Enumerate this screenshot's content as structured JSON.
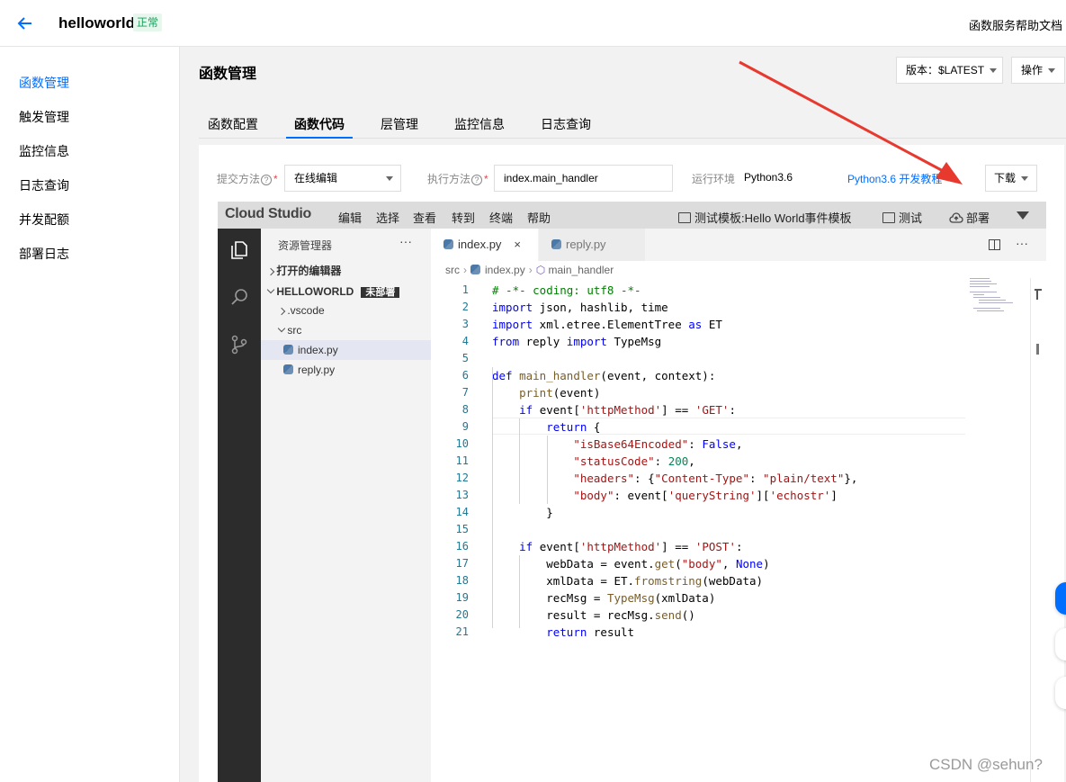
{
  "header": {
    "title": "helloworld",
    "status": "正常",
    "help": "函数服务帮助文档"
  },
  "sidebar": {
    "items": [
      {
        "label": "函数管理",
        "active": true
      },
      {
        "label": "触发管理"
      },
      {
        "label": "监控信息"
      },
      {
        "label": "日志查询"
      },
      {
        "label": "并发配额"
      },
      {
        "label": "部署日志"
      }
    ]
  },
  "main": {
    "title": "函数管理",
    "version_label": "版本：$LATEST",
    "ops_label": "操作",
    "tabs": [
      {
        "label": "函数配置"
      },
      {
        "label": "函数代码",
        "active": true
      },
      {
        "label": "层管理"
      },
      {
        "label": "监控信息"
      },
      {
        "label": "日志查询"
      }
    ]
  },
  "form": {
    "submit_method_label": "提交方法",
    "submit_method_value": "在线编辑",
    "exec_method_label": "执行方法",
    "exec_method_value": "index.main_handler",
    "runtime_label": "运行环境",
    "runtime_value": "Python3.6",
    "tutorial_link": "Python3.6 开发教程",
    "download_label": "下载",
    "help_glyph": "?",
    "required_mark": "*"
  },
  "ide": {
    "logo": "Cloud Studio",
    "menus": [
      "编辑",
      "选择",
      "查看",
      "转到",
      "终端",
      "帮助"
    ],
    "test_template": "测试模板:Hello World事件模板",
    "test": "测试",
    "deploy": "部署",
    "explorer": {
      "title": "资源管理器",
      "dots": "···",
      "open_editors": "打开的编辑器",
      "project": "HELLOWORLD",
      "project_badge": "未部署",
      "items": [
        ".vscode",
        "src",
        "index.py",
        "reply.py"
      ]
    },
    "tabs": [
      {
        "label": "index.py",
        "active": true,
        "close": "×"
      },
      {
        "label": "reply.py"
      }
    ],
    "editor_dots": "···",
    "breadcrumb": [
      "src",
      "index.py",
      "main_handler"
    ],
    "code_lines": [
      "# -*- coding: utf8 -*-",
      "import json, hashlib, time",
      "import xml.etree.ElementTree as ET",
      "from reply import TypeMsg",
      "",
      "def main_handler(event, context):",
      "    print(event)",
      "    if event['httpMethod'] == 'GET':",
      "        return {",
      "            \"isBase64Encoded\": False,",
      "            \"statusCode\": 200,",
      "            \"headers\": {\"Content-Type\": \"plain/text\"},",
      "            \"body\": event['queryString']['echostr']",
      "        }",
      "",
      "    if event['httpMethod'] == 'POST':",
      "        webData = event.get(\"body\", None)",
      "        xmlData = ET.fromstring(webData)",
      "        recMsg = TypeMsg(xmlData)",
      "        result = recMsg.send()",
      "        return result"
    ]
  },
  "watermark": "CSDN @sehun?",
  "colors": {
    "accent": "#006eff",
    "status_green": "#1e9e5a",
    "arrow_red": "#e8392f"
  }
}
